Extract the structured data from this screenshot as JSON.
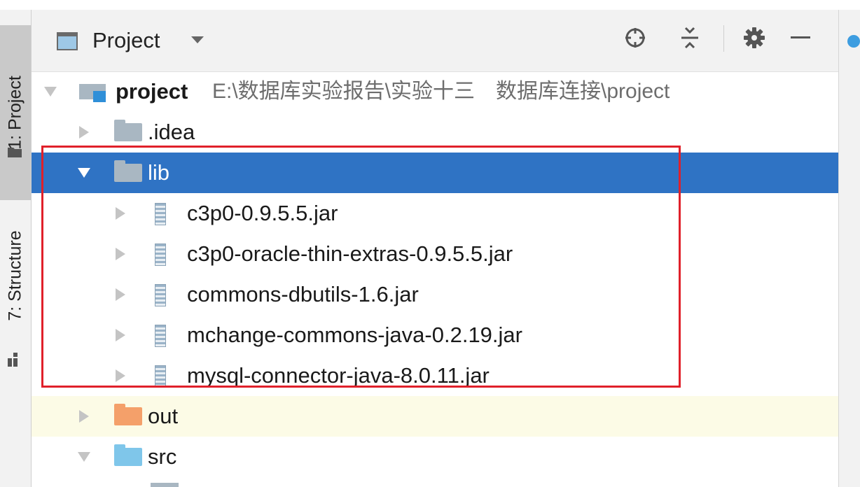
{
  "tool_strip": {
    "tabs": [
      {
        "label": "1: Project",
        "active": true
      },
      {
        "label": "7: Structure",
        "active": false
      }
    ]
  },
  "panel": {
    "title": "Project",
    "tools": [
      "locate-icon",
      "collapse-icon",
      "gear-icon",
      "minimize-icon"
    ]
  },
  "tree": {
    "root": {
      "label": "project",
      "path": "E:\\数据库实验报告\\实验十三　数据库连接\\project"
    },
    "idea": {
      "label": ".idea"
    },
    "lib": {
      "label": "lib"
    },
    "jars": [
      {
        "label": "c3p0-0.9.5.5.jar"
      },
      {
        "label": "c3p0-oracle-thin-extras-0.9.5.5.jar"
      },
      {
        "label": "commons-dbutils-1.6.jar"
      },
      {
        "label": "mchange-commons-java-0.2.19.jar"
      },
      {
        "label": "mysql-connector-java-8.0.11.jar"
      }
    ],
    "out": {
      "label": "out"
    },
    "src": {
      "label": "src"
    }
  },
  "colors": {
    "selection": "#2f73c4",
    "highlight_row": "#fcfbe6",
    "annotation_box": "#e0202a",
    "folder": "#a9b7c2",
    "out_folder": "#f4a06a",
    "src_folder": "#7fc6ea"
  }
}
